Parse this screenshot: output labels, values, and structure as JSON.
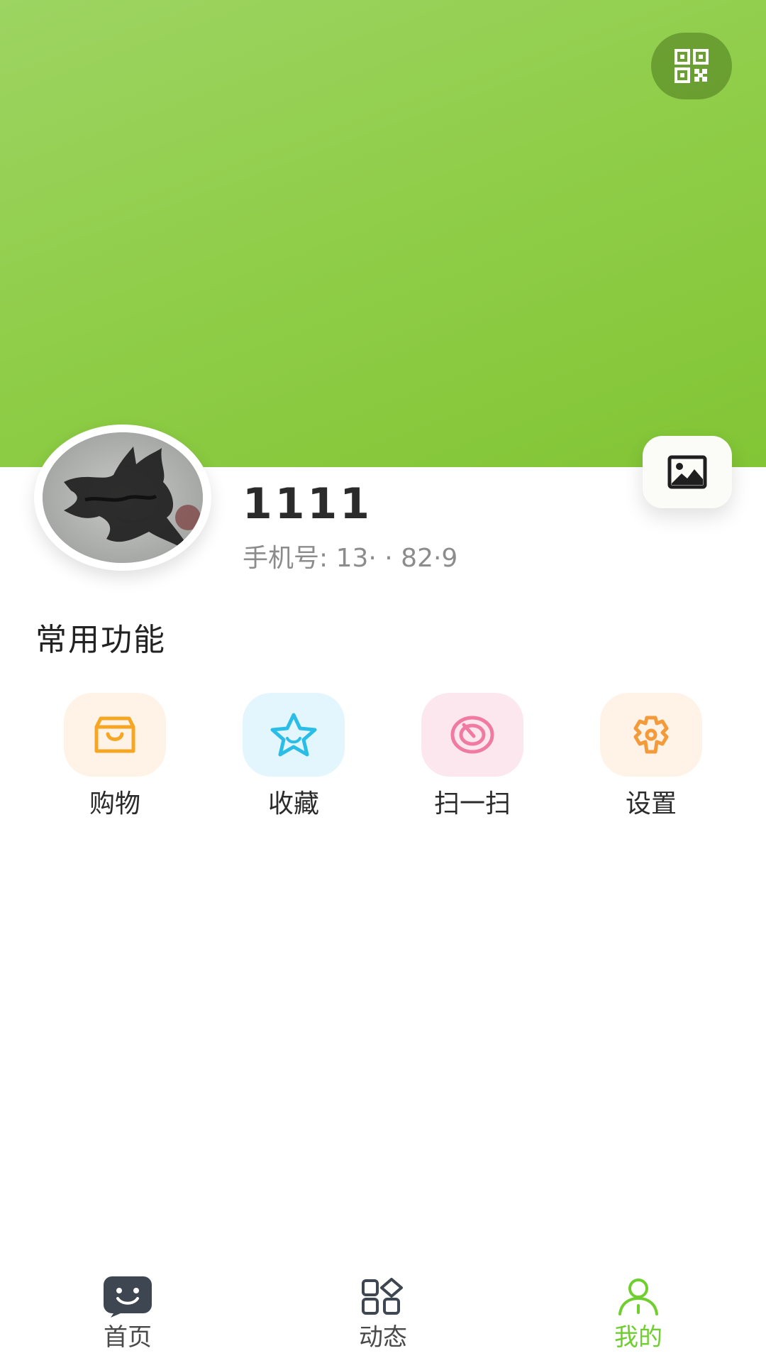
{
  "profile": {
    "name": "1111",
    "phone_label": "手机号:",
    "phone_value": "13·  · 82·9"
  },
  "section": {
    "title": "常用功能"
  },
  "features": [
    {
      "label": "购物",
      "icon": "shopping-bag-icon",
      "color": "#f5a623",
      "bg": "#fff3e8"
    },
    {
      "label": "收藏",
      "icon": "star-icon",
      "color": "#29bde8",
      "bg": "#e4f6fd"
    },
    {
      "label": "扫一扫",
      "icon": "scan-icon",
      "color": "#f07aa1",
      "bg": "#fde7ef"
    },
    {
      "label": "设置",
      "icon": "gear-icon",
      "color": "#f39a3a",
      "bg": "#fff3e8"
    }
  ],
  "tabs": [
    {
      "label": "首页",
      "icon": "chat-icon",
      "active": false
    },
    {
      "label": "动态",
      "icon": "apps-icon",
      "active": false
    },
    {
      "label": "我的",
      "icon": "user-icon",
      "active": true
    }
  ],
  "colors": {
    "header": "#8fcd48",
    "active_tab": "#6fcf2e",
    "text": "#2b2b2b",
    "muted": "#8c8c8c"
  }
}
